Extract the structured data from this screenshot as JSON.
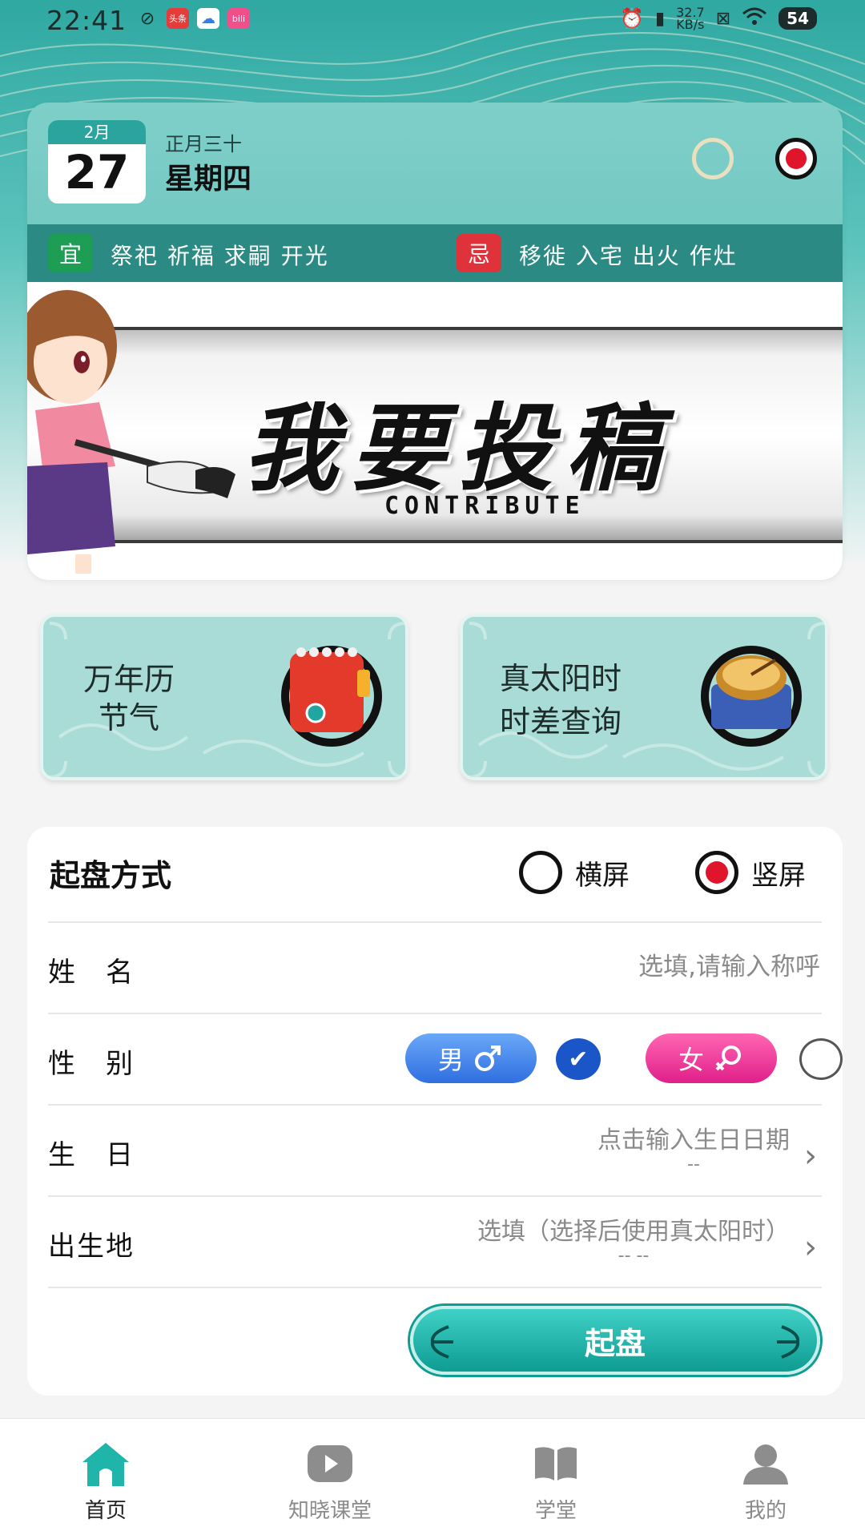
{
  "status_bar": {
    "time": "22:41",
    "app_icons": [
      {
        "icon": "leaf-icon",
        "text": ""
      },
      {
        "icon": "toutiao-icon",
        "text": "头条"
      },
      {
        "icon": "cloud-icon",
        "text": ""
      },
      {
        "icon": "bilibili-icon",
        "text": "bili"
      }
    ],
    "speed_value": "32.7",
    "speed_unit": "KB/s",
    "battery": "54"
  },
  "calendar": {
    "month": "2月",
    "day": "27",
    "lunar": "正月三十",
    "weekday": "星期四"
  },
  "almanac": {
    "yi_label": "宜",
    "yi_items": "祭祀 祈福 求嗣 开光",
    "ji_label": "忌",
    "ji_items": "移徙 入宅 出火 作灶"
  },
  "banner": {
    "title": "我要投稿",
    "subtitle": "CONTRIBUTE"
  },
  "features": [
    {
      "line1": "万年历",
      "line2": "节气"
    },
    {
      "line1": "真太阳时",
      "line2": "时差查询"
    }
  ],
  "form": {
    "title": "起盘方式",
    "orientation_options": [
      "横屏",
      "竖屏"
    ],
    "selected_orientation": "竖屏",
    "name_label": "姓　名",
    "name_placeholder": "选填,请输入称呼",
    "gender_label": "性　别",
    "gender_male": "男",
    "gender_female": "女",
    "selected_gender": "男",
    "birthday_label": "生　日",
    "birthday_hint": "点击输入生日日期",
    "birthday_sub": "--",
    "birthplace_label": "出生地",
    "birthplace_hint": "选填（选择后使用真太阳时）",
    "birthplace_sub": "-- --",
    "submit_label": "起盘"
  },
  "bottom_nav": [
    {
      "label": "首页",
      "icon": "home-icon",
      "active": true
    },
    {
      "label": "知晓课堂",
      "icon": "video-play-icon",
      "active": false
    },
    {
      "label": "学堂",
      "icon": "book-icon",
      "active": false
    },
    {
      "label": "我的",
      "icon": "user-icon",
      "active": false
    }
  ],
  "colors": {
    "accent": "#2aa49d",
    "yi": "#1e9e55",
    "ji": "#e0323a",
    "male": "#2f6fe0",
    "female": "#e01f8a"
  }
}
